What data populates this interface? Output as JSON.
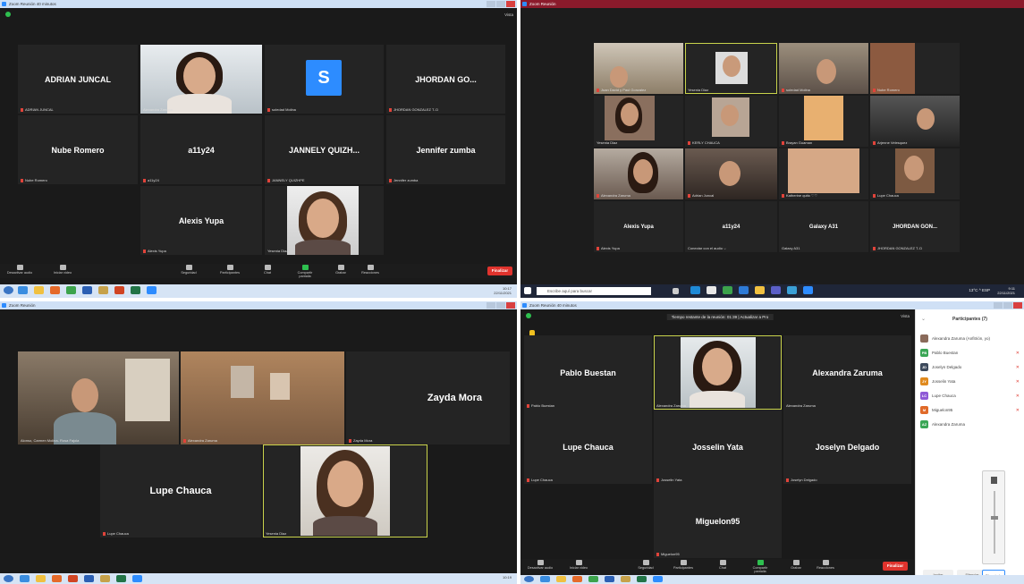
{
  "q1": {
    "window_title": "Zoom Reunión 40 minutos",
    "view_label": "Vista",
    "tiles": [
      {
        "name": "ADRIAN JUNCAL",
        "label": "ADRIAN JUNCAL"
      },
      {
        "name": "",
        "label": "Alexandra Zaruma"
      },
      {
        "name": "S",
        "label": "soledad Molina"
      },
      {
        "name": "JHORDAN    GO...",
        "label": "JHORDAN   GONZALEZ T..D"
      },
      {
        "name": "Nube Romero",
        "label": "Nube Romero"
      },
      {
        "name": "a11y24",
        "label": "a11y24"
      },
      {
        "name": "JANNELY  QUIZH...",
        "label": "JANNELY QUIZHPE"
      },
      {
        "name": "Jennifer zumba",
        "label": "Jennifer zumba"
      },
      {
        "name": "Alexis Yupa",
        "label": "Alexis Yupa"
      },
      {
        "name": "",
        "label": "Yesenia Diaz"
      }
    ],
    "controls": {
      "mute": "Desactivar audio",
      "video": "Iniciar video",
      "security": "Seguridad",
      "participants": "Participantes",
      "participants_count": "10",
      "chat": "Chat",
      "share": "Compartir pantalla",
      "record": "Grabar",
      "reactions": "Reacciones",
      "end": "Finalizar"
    },
    "clock": {
      "time": "10:17",
      "date": "22/11/2021"
    }
  },
  "q2": {
    "window_title": "Zoom Reunión",
    "tiles": [
      {
        "name": "",
        "label": "Juan David y Paul Gonzalez"
      },
      {
        "name": "",
        "label": "Yesenia Diaz"
      },
      {
        "name": "",
        "label": "soledad Molina"
      },
      {
        "name": "",
        "label": "Nube Romero"
      },
      {
        "name": "",
        "label": "Yesenia Diaz"
      },
      {
        "name": "",
        "label": "KERLY  CHAUCA"
      },
      {
        "name": "",
        "label": "Brayan Guaman"
      },
      {
        "name": "",
        "label": "Arjenne Velesquez"
      },
      {
        "name": "",
        "label": "Alexandra Zaruma"
      },
      {
        "name": "",
        "label": "Adrian Juncal"
      },
      {
        "name": "",
        "label": "Katherine quito  ♡♡"
      },
      {
        "name": "",
        "label": "Lupe Chauca"
      },
      {
        "name": "Alexis Yupa",
        "label": "Alexis Yupa"
      },
      {
        "name": "a11y24",
        "label": "Conectar con el audio ⌵"
      },
      {
        "name": "Galaxy A31",
        "label": "Galaxy A31"
      },
      {
        "name": "JHORDAN    GON...",
        "label": "JHORDAN   GONZALEZ T..D"
      }
    ],
    "search_placeholder": "Escribe aquí para buscar",
    "tray": "13°C  ^  ESP",
    "clock": {
      "time": "9:11",
      "date": "22/11/2021"
    }
  },
  "q3": {
    "window_title": "Zoom Reunión",
    "tiles": [
      {
        "name": "",
        "label": "Alonso, Carmen Molina- Rosa Fajola"
      },
      {
        "name": "",
        "label": "Alexandra Zaruma"
      },
      {
        "name": "Zayda Mora",
        "label": "Zayda Mora"
      },
      {
        "name": "Lupe Chauca",
        "label": "Lupe Chauca"
      },
      {
        "name": "",
        "label": "Yesenia Diaz"
      }
    ],
    "clock": {
      "time": "10:19",
      "date": ""
    }
  },
  "q4": {
    "window_title": "Zoom Reunión 40 minutos",
    "view_label": "Vista",
    "banner": "Tiempo restante de la reunión: 01:39 | Actualizar a Pro",
    "tiles": [
      {
        "name": "Pablo Buestan",
        "label": "Pablo Buestan"
      },
      {
        "name": "",
        "label": "Alexandra Zaruma"
      },
      {
        "name": "Alexandra Zaruma",
        "label": "Alexandra Zaruma"
      },
      {
        "name": "Lupe Chauca",
        "label": "Lupe Chauca"
      },
      {
        "name": "Josselin Yata",
        "label": "Josselin Yata"
      },
      {
        "name": "Joselyn Delgado",
        "label": "Joselyn Delgado"
      },
      {
        "name": "Miguelon95",
        "label": "Miguelon95"
      }
    ],
    "panel": {
      "title": "Participantes (7)",
      "rows": [
        {
          "initials": "",
          "name": "Alexandra Zaruma (Anfitrión, yo)",
          "color": "#8a6a5a"
        },
        {
          "initials": "PB",
          "name": "Pablo Buestan",
          "color": "#3aa655"
        },
        {
          "initials": "JD",
          "name": "Joselyn Delgado",
          "color": "#3d4a5c"
        },
        {
          "initials": "JY",
          "name": "Josselin Yata",
          "color": "#e08a1e"
        },
        {
          "initials": "LC",
          "name": "Lupe Chauca",
          "color": "#8e5ad6"
        },
        {
          "initials": "M",
          "name": "Miguelon95",
          "color": "#e06a2a"
        },
        {
          "initials": "AZ",
          "name": "Alexandra Zaruma",
          "color": "#3aa655"
        }
      ],
      "invite": "Invitar",
      "mute_all": "Silenciar",
      "unmute": "Silenciado"
    },
    "controls": {
      "mute": "Desactivar audio",
      "video": "Iniciar video",
      "security": "Seguridad",
      "participants": "Participantes",
      "participants_count": "7",
      "chat": "Chat",
      "share": "Compartir pantalla",
      "record": "Grabar",
      "reactions": "Reacciones",
      "end": "Finalizar"
    }
  }
}
